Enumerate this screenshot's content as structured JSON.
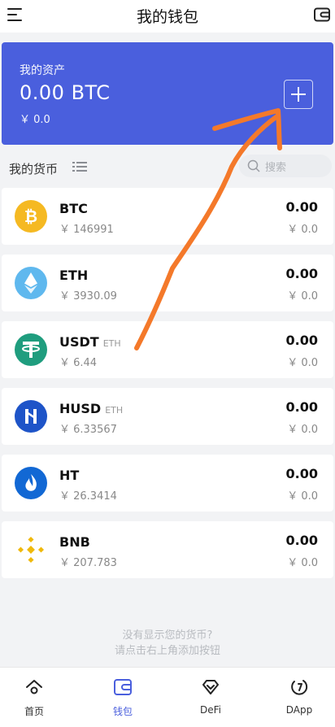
{
  "header": {
    "title": "我的钱包",
    "menu_icon": "menu-icon",
    "wallet_icon": "wallet-icon"
  },
  "asset": {
    "label": "我的资产",
    "value": "0.00 BTC",
    "cny": "￥ 0.0",
    "add_icon": "plus-icon"
  },
  "currencies": {
    "title": "我的货币",
    "search_placeholder": "搜索"
  },
  "coins": [
    {
      "symbol": "BTC",
      "chain": "",
      "price": "￥ 146991",
      "amount": "0.00",
      "cny": "￥ 0.0",
      "icon": "btc-icon",
      "color": "#f5b922"
    },
    {
      "symbol": "ETH",
      "chain": "",
      "price": "￥ 3930.09",
      "amount": "0.00",
      "cny": "￥ 0.0",
      "icon": "eth-icon",
      "color": "#5fb8ee"
    },
    {
      "symbol": "USDT",
      "chain": "ETH",
      "price": "￥ 6.44",
      "amount": "0.00",
      "cny": "￥ 0.0",
      "icon": "usdt-icon",
      "color": "#1f9d7e"
    },
    {
      "symbol": "HUSD",
      "chain": "ETH",
      "price": "￥ 6.33567",
      "amount": "0.00",
      "cny": "￥ 0.0",
      "icon": "husd-icon",
      "color": "#1e54c8"
    },
    {
      "symbol": "HT",
      "chain": "",
      "price": "￥ 26.3414",
      "amount": "0.00",
      "cny": "￥ 0.0",
      "icon": "ht-icon",
      "color": "#1268d4"
    },
    {
      "symbol": "BNB",
      "chain": "",
      "price": "￥ 207.783",
      "amount": "0.00",
      "cny": "￥ 0.0",
      "icon": "bnb-icon",
      "color": "#f0b90b"
    }
  ],
  "hint": {
    "line1": "没有显示您的货币?",
    "line2": "请点击右上角添加按钮"
  },
  "tabs": [
    {
      "label": "首页",
      "icon": "home-icon"
    },
    {
      "label": "钱包",
      "icon": "wallet-tab-icon",
      "active": true
    },
    {
      "label": "DeFi",
      "icon": "defi-icon"
    },
    {
      "label": "DApp",
      "icon": "dapp-icon"
    }
  ],
  "colors": {
    "accent": "#4a5fdd",
    "annotation_arrow": "#f4792a"
  }
}
